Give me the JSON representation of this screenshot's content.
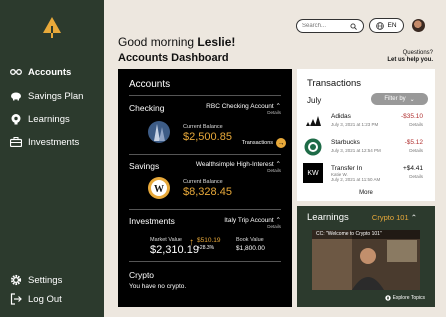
{
  "sidebar": {
    "items": [
      {
        "label": "Accounts",
        "icon": "glasses-icon"
      },
      {
        "label": "Savings Plan",
        "icon": "piggy-bank-icon"
      },
      {
        "label": "Learnings",
        "icon": "brain-icon"
      },
      {
        "label": "Investments",
        "icon": "briefcase-icon"
      }
    ],
    "bottom": [
      {
        "label": "Settings",
        "icon": "gear-icon"
      },
      {
        "label": "Log Out",
        "icon": "logout-icon"
      }
    ]
  },
  "topbar": {
    "search_placeholder": "Search...",
    "lang": "EN"
  },
  "greeting": {
    "prefix": "Good morning",
    "name": "Leslie!"
  },
  "dashboard_title": "Accounts Dashboard",
  "help": {
    "line1": "Questions?",
    "line2": "Let us help you."
  },
  "accounts": {
    "title": "Accounts",
    "checking": {
      "title": "Checking",
      "account": "RBC Checking Account",
      "details": "Details",
      "balance_label": "Current Balance",
      "balance": "$2,500.85",
      "link": "Transactions"
    },
    "savings": {
      "title": "Savings",
      "account": "Wealthsimple High-Interest",
      "details": "Details",
      "balance_label": "Current Balance",
      "balance": "$8,328.45"
    },
    "investments": {
      "title": "Investments",
      "account": "Italy Trip Account",
      "details": "Details",
      "market_label": "Market Value",
      "market_value": "$2,310.19",
      "change_value": "$510.19",
      "change_pct": "+28.3%",
      "book_label": "Book Value",
      "book_value": "$1,800.00"
    },
    "crypto": {
      "title": "Crypto",
      "text": "You have no crypto."
    }
  },
  "transactions": {
    "title": "Transactions",
    "month": "July",
    "filter": "Filter by",
    "rows": [
      {
        "name": "Adidas",
        "date": "July 3, 2021 at 1:23 PM",
        "amount": "-$35.10",
        "details": "Details"
      },
      {
        "name": "Starbucks",
        "date": "July 3, 2021 at 12:54 PM",
        "amount": "-$5.12",
        "details": "Details"
      },
      {
        "name": "Transfer In",
        "sub": "Katie W.",
        "date": "July 2, 2021 at 11:50 AM",
        "amount": "+$4.41",
        "details": "Details"
      }
    ],
    "more": "More"
  },
  "learnings": {
    "title": "Learnings",
    "course": "Crypto 101",
    "video_title": "CC: \"Welcome to Crypto 101\"",
    "explore": "Explore Topics"
  },
  "colors": {
    "sidebar": "#2c3a2d",
    "accent": "#e8a93a",
    "negative": "#b03030",
    "background": "#ede7df"
  }
}
